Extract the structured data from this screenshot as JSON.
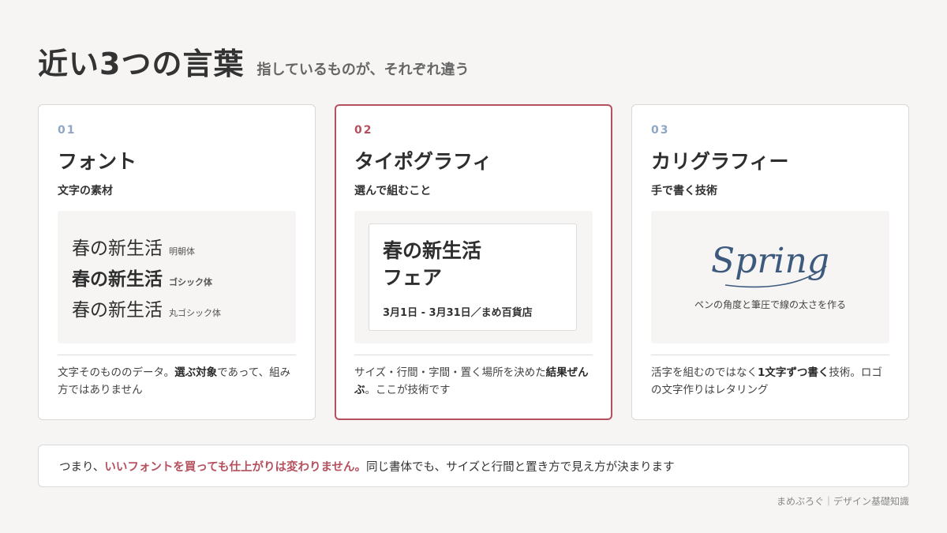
{
  "header": {
    "title": "近い3つの言葉",
    "subtitle": "指しているものが、それぞれ違う"
  },
  "cards": [
    {
      "number": "01",
      "title": "フォント",
      "subtitle": "文字の素材",
      "samples": [
        {
          "text": "春の新生活",
          "label": "明朝体"
        },
        {
          "text": "春の新生活",
          "label": "ゴシック体"
        },
        {
          "text": "春の新生活",
          "label": "丸ゴシック体"
        }
      ],
      "desc_a": "文字そのもののデータ。",
      "desc_b": "選ぶ対象",
      "desc_c": "であって、組み方ではありません"
    },
    {
      "number": "02",
      "title": "タイポグラフィ",
      "subtitle": "選んで組むこと",
      "poster": {
        "line1": "春の新生活",
        "line2": "フェア",
        "date": "3月1日 - 3月31日／まめ百貨店"
      },
      "desc_a": "サイズ・行間・字間・置く場所を決めた",
      "desc_b": "結果ぜんぶ",
      "desc_c": "。ここが技術です"
    },
    {
      "number": "03",
      "title": "カリグラフィー",
      "subtitle": "手で書く技術",
      "script_word": "Spring",
      "caption": "ペンの角度と筆圧で線の太さを作る",
      "desc_a": "活字を組むのではなく",
      "desc_b": "1文字ずつ書く",
      "desc_c": "技術。ロゴの文字作りはレタリング"
    }
  ],
  "summary": {
    "lead": "つまり、",
    "highlight": "いいフォントを買っても仕上がりは変わりません。",
    "rest": "同じ書体でも、サイズと行間と置き方で見え方が決まります"
  },
  "footer": "まめぶろぐ｜デザイン基礎知識",
  "colors": {
    "accent": "#b5505d",
    "number_blue": "#8fa6c4",
    "script_ink": "#3d5a7e",
    "background": "#f6f5f3"
  }
}
